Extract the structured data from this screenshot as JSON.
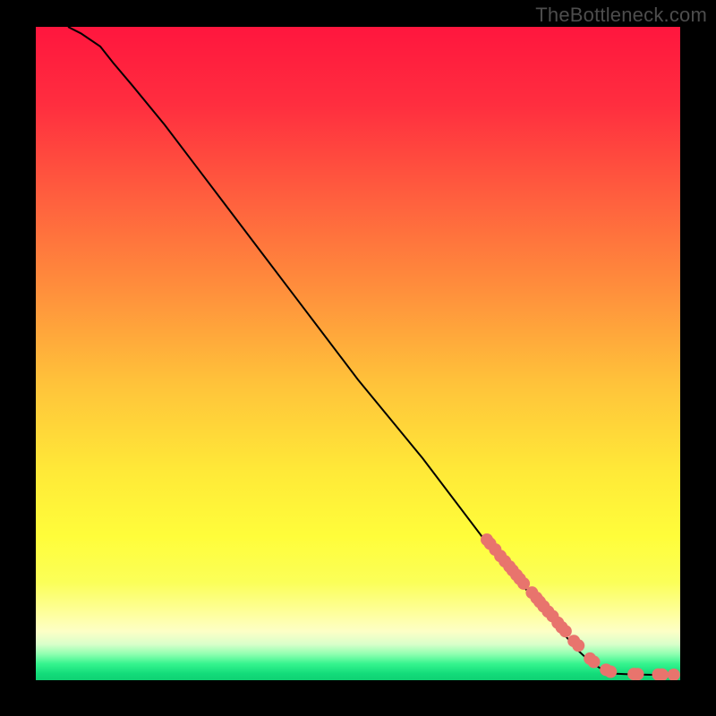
{
  "attribution": "TheBottleneck.com",
  "chart_data": {
    "type": "line",
    "title": "",
    "xlabel": "",
    "ylabel": "",
    "xlim": [
      0,
      100
    ],
    "ylim": [
      0,
      100
    ],
    "grid": false,
    "legend": false,
    "background_gradient": {
      "stops": [
        {
          "pos": 0.0,
          "color": "#ff163e"
        },
        {
          "pos": 0.12,
          "color": "#ff2e3f"
        },
        {
          "pos": 0.25,
          "color": "#ff5b3e"
        },
        {
          "pos": 0.4,
          "color": "#ff8e3c"
        },
        {
          "pos": 0.55,
          "color": "#ffc43a"
        },
        {
          "pos": 0.68,
          "color": "#ffe938"
        },
        {
          "pos": 0.78,
          "color": "#fffd3a"
        },
        {
          "pos": 0.85,
          "color": "#fbff58"
        },
        {
          "pos": 0.9,
          "color": "#feffa0"
        },
        {
          "pos": 0.925,
          "color": "#fdffc6"
        },
        {
          "pos": 0.945,
          "color": "#d9ffca"
        },
        {
          "pos": 0.96,
          "color": "#8fffb0"
        },
        {
          "pos": 0.975,
          "color": "#35f48e"
        },
        {
          "pos": 0.99,
          "color": "#13dc7a"
        },
        {
          "pos": 1.0,
          "color": "#0fd173"
        }
      ]
    },
    "series": [
      {
        "name": "curve",
        "style": "line",
        "color": "#000000",
        "x": [
          5,
          7,
          10,
          12,
          15,
          20,
          25,
          30,
          35,
          40,
          45,
          50,
          55,
          60,
          65,
          70,
          73,
          76,
          79,
          82,
          84,
          85.5,
          87,
          88,
          89,
          90,
          92,
          94,
          96,
          98,
          99
        ],
        "y": [
          100,
          99,
          97,
          94.5,
          91,
          85,
          78.5,
          72,
          65.5,
          59,
          52.5,
          46,
          40,
          34,
          27.5,
          21,
          17.5,
          14,
          10.5,
          7,
          4.7,
          3.3,
          2.2,
          1.6,
          1.2,
          1.0,
          0.9,
          0.85,
          0.83,
          0.82,
          0.82
        ]
      },
      {
        "name": "points",
        "style": "scatter",
        "color": "#e8746d",
        "x": [
          70.0,
          70.5,
          71.3,
          72.1,
          72.8,
          73.5,
          74.0,
          74.6,
          75.1,
          75.7,
          77.0,
          77.7,
          78.2,
          78.8,
          79.5,
          80.2,
          81.0,
          81.6,
          82.2,
          83.5,
          84.2,
          86.0,
          86.6,
          88.5,
          89.2,
          92.8,
          93.4,
          96.6,
          97.2,
          99.0
        ],
        "y": [
          21.5,
          20.9,
          20.0,
          19.0,
          18.2,
          17.4,
          16.8,
          16.1,
          15.5,
          14.8,
          13.4,
          12.6,
          12.0,
          11.3,
          10.5,
          9.8,
          8.8,
          8.1,
          7.5,
          6.0,
          5.3,
          3.3,
          2.8,
          1.6,
          1.3,
          0.95,
          0.93,
          0.86,
          0.85,
          0.83
        ]
      }
    ]
  }
}
